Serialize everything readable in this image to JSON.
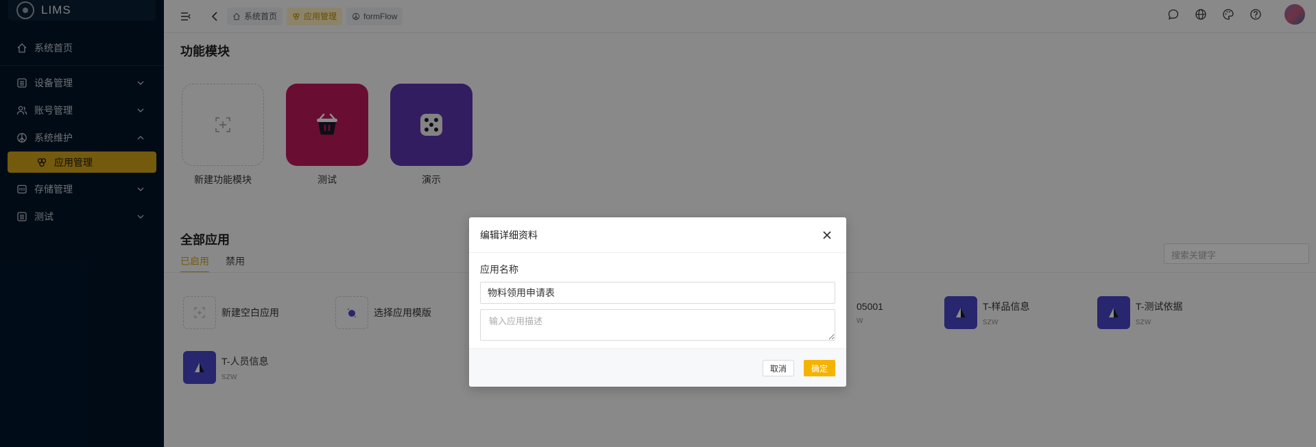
{
  "app": {
    "name": "LIMS"
  },
  "sidebar": {
    "home": "系统首页",
    "items": [
      {
        "label": "设备管理",
        "icon": "table-icon"
      },
      {
        "label": "账号管理",
        "icon": "users-icon"
      },
      {
        "label": "系统维护",
        "icon": "peace-icon"
      }
    ],
    "sub_active": "应用管理",
    "items2": [
      {
        "label": "存储管理",
        "icon": "storage-icon"
      },
      {
        "label": "测试",
        "icon": "table-icon"
      }
    ]
  },
  "header": {
    "tabs": [
      {
        "label": "系统首页",
        "active": false
      },
      {
        "label": "应用管理",
        "active": true
      },
      {
        "label": "formFlow",
        "active": false
      }
    ]
  },
  "content": {
    "modules_title": "功能模块",
    "modules": [
      {
        "label": "新建功能模块",
        "color": ""
      },
      {
        "label": "测试",
        "color": "#c2185b"
      },
      {
        "label": "演示",
        "color": "#5e35b1"
      }
    ],
    "apps_title": "全部应用",
    "tabs": [
      {
        "label": "已启用",
        "active": true
      },
      {
        "label": "禁用",
        "active": false
      }
    ],
    "search_placeholder": "搜索关键字",
    "apps": [
      {
        "name": "新建空白应用"
      },
      {
        "name": "选择应用模版"
      },
      {
        "name": "05001",
        "sub": "w"
      },
      {
        "name": "T-样品信息",
        "sub": "szw"
      },
      {
        "name": "T-测试依据",
        "sub": "szw"
      },
      {
        "name": "T-人员信息",
        "sub": "szw"
      }
    ]
  },
  "modal": {
    "title": "编辑详细资料",
    "field_label": "应用名称",
    "name_value": "物料领用申请表",
    "desc_placeholder": "输入应用描述",
    "cancel": "取消",
    "ok": "确定"
  },
  "colors": {
    "accent": "#d4a418",
    "primary": "#f5b301",
    "sidebar": "#001529"
  }
}
